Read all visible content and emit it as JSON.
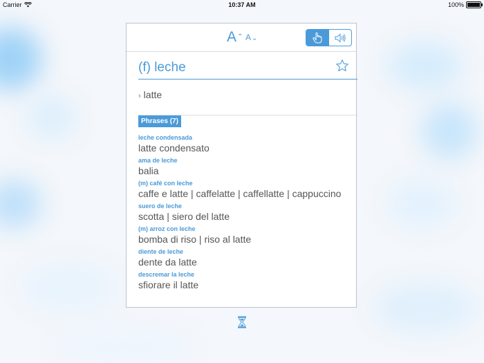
{
  "status_bar": {
    "carrier": "Carrier",
    "time": "10:37 AM",
    "battery": "100%",
    "wifi_icon": "wifi-icon",
    "battery_icon": "battery-icon"
  },
  "colors": {
    "accent": "#4a9ad9",
    "text": "#555555",
    "border": "#b9c3cf"
  },
  "toolbar": {
    "font_increase_label": "A",
    "font_decrease_label": "A",
    "font_increase_icon": "font-increase-icon",
    "font_decrease_icon": "font-decrease-icon",
    "mode_options": [
      {
        "icon": "hand-pointer-icon",
        "active": true
      },
      {
        "icon": "speaker-icon",
        "active": false
      }
    ]
  },
  "search": {
    "term": "(f) leche",
    "favorite_icon": "star-icon"
  },
  "translation": {
    "arrow": "›",
    "text": "latte"
  },
  "phrases": {
    "header": "Phrases (7)",
    "items": [
      {
        "source": "leche condensada",
        "target": "latte condensato"
      },
      {
        "source": "ama de leche",
        "target": "balia"
      },
      {
        "source": "(m) café con leche",
        "target": "caffe e latte | caffelatte | caffellatte | cappuccino"
      },
      {
        "source": "suero de leche",
        "target": "scotta | siero del latte"
      },
      {
        "source": "(m) arroz con leche",
        "target": "bomba di riso | riso al latte"
      },
      {
        "source": "diente de leche",
        "target": "dente da latte"
      },
      {
        "source": "descremar la leche",
        "target": "sfiorare il latte"
      }
    ]
  },
  "footer": {
    "history_icon": "hourglass-icon"
  }
}
